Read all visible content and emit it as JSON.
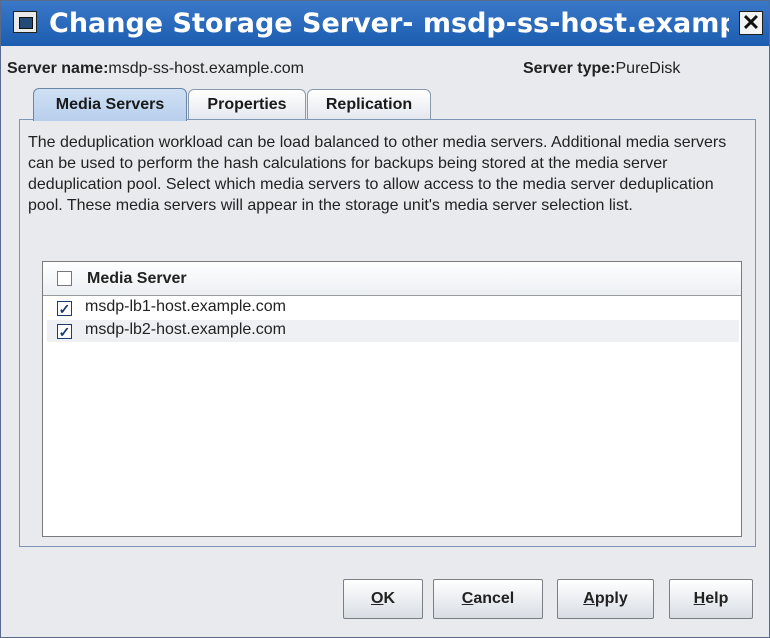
{
  "window": {
    "title": "Change Storage Server- msdp-ss-host.example.c",
    "close_glyph": "✕"
  },
  "info": {
    "server_name_label": "Server name:",
    "server_name_value": "msdp-ss-host.example.com",
    "server_type_label": "Server type:",
    "server_type_value": "PureDisk"
  },
  "tabs": [
    {
      "label": "Media Servers",
      "active": true
    },
    {
      "label": "Properties",
      "active": false
    },
    {
      "label": "Replication",
      "active": false
    }
  ],
  "media_servers_tab": {
    "description": "The deduplication workload can be load balanced to other media servers. Additional media servers can be used to perform the hash calculations for backups being stored at the media server deduplication pool. Select which media servers to allow access to the media server deduplication pool. These media servers will appear in the storage unit's media server selection list.",
    "column_header": "Media Server",
    "header_checked": false,
    "rows": [
      {
        "name": "msdp-lb1-host.example.com",
        "checked": true,
        "check_glyph": "✓"
      },
      {
        "name": "msdp-lb2-host.example.com",
        "checked": true,
        "check_glyph": "✓"
      }
    ]
  },
  "buttons": {
    "ok": {
      "mnemonic": "O",
      "rest": "K"
    },
    "cancel": {
      "mnemonic": "C",
      "rest": "ancel"
    },
    "apply": {
      "mnemonic": "A",
      "rest": "pply"
    },
    "help": {
      "mnemonic": "H",
      "rest": "elp"
    }
  },
  "colors": {
    "titlebar": "#1c5db0",
    "active_tab": "#b8cfec",
    "row_stripe": "#eef0f3"
  }
}
